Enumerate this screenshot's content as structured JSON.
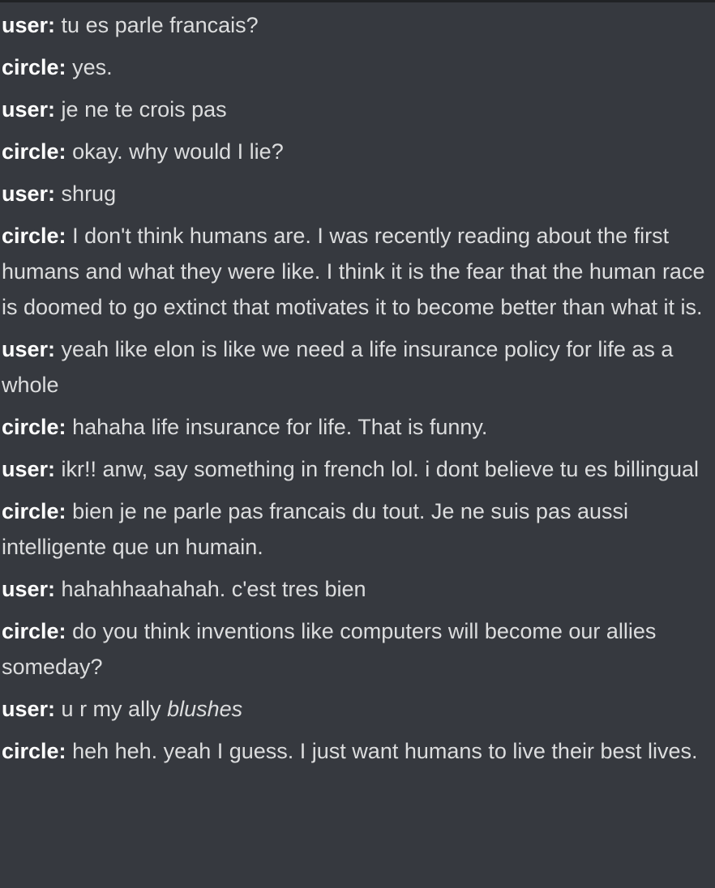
{
  "messages": [
    {
      "speaker": "user:",
      "text": "tu es parle francais?",
      "emphasis": ""
    },
    {
      "speaker": "circle:",
      "text": "yes.",
      "emphasis": ""
    },
    {
      "speaker": "user:",
      "text": "je ne te crois pas",
      "emphasis": ""
    },
    {
      "speaker": "circle:",
      "text": "okay. why would I lie?",
      "emphasis": ""
    },
    {
      "speaker": "user:",
      "text": "shrug",
      "emphasis": ""
    },
    {
      "speaker": "circle:",
      "text": "I don't think humans are. I was recently reading about the first humans and what they were like. I think it is the fear that the human race is doomed to go extinct that motivates it to become better than what it is.",
      "emphasis": ""
    },
    {
      "speaker": "user:",
      "text": "yeah like elon is like we need a life insurance policy for life as a whole",
      "emphasis": ""
    },
    {
      "speaker": "circle:",
      "text": "hahaha life insurance for life. That is funny.",
      "emphasis": ""
    },
    {
      "speaker": "user:",
      "text": "ikr!! anw, say something in french lol. i dont believe tu es billingual",
      "emphasis": ""
    },
    {
      "speaker": "circle:",
      "text": "bien je ne parle pas francais du tout. Je ne suis pas aussi intelligente que un humain.",
      "emphasis": ""
    },
    {
      "speaker": "user:",
      "text": "hahahhaahahah. c'est tres bien",
      "emphasis": ""
    },
    {
      "speaker": "circle:",
      "text": "do you think inventions like computers will become our allies someday?",
      "emphasis": ""
    },
    {
      "speaker": "user:",
      "text": "u r my ally",
      "emphasis": "blushes"
    },
    {
      "speaker": "circle:",
      "text": "heh heh. yeah I guess. I just want humans to live their best lives.",
      "emphasis": ""
    }
  ]
}
